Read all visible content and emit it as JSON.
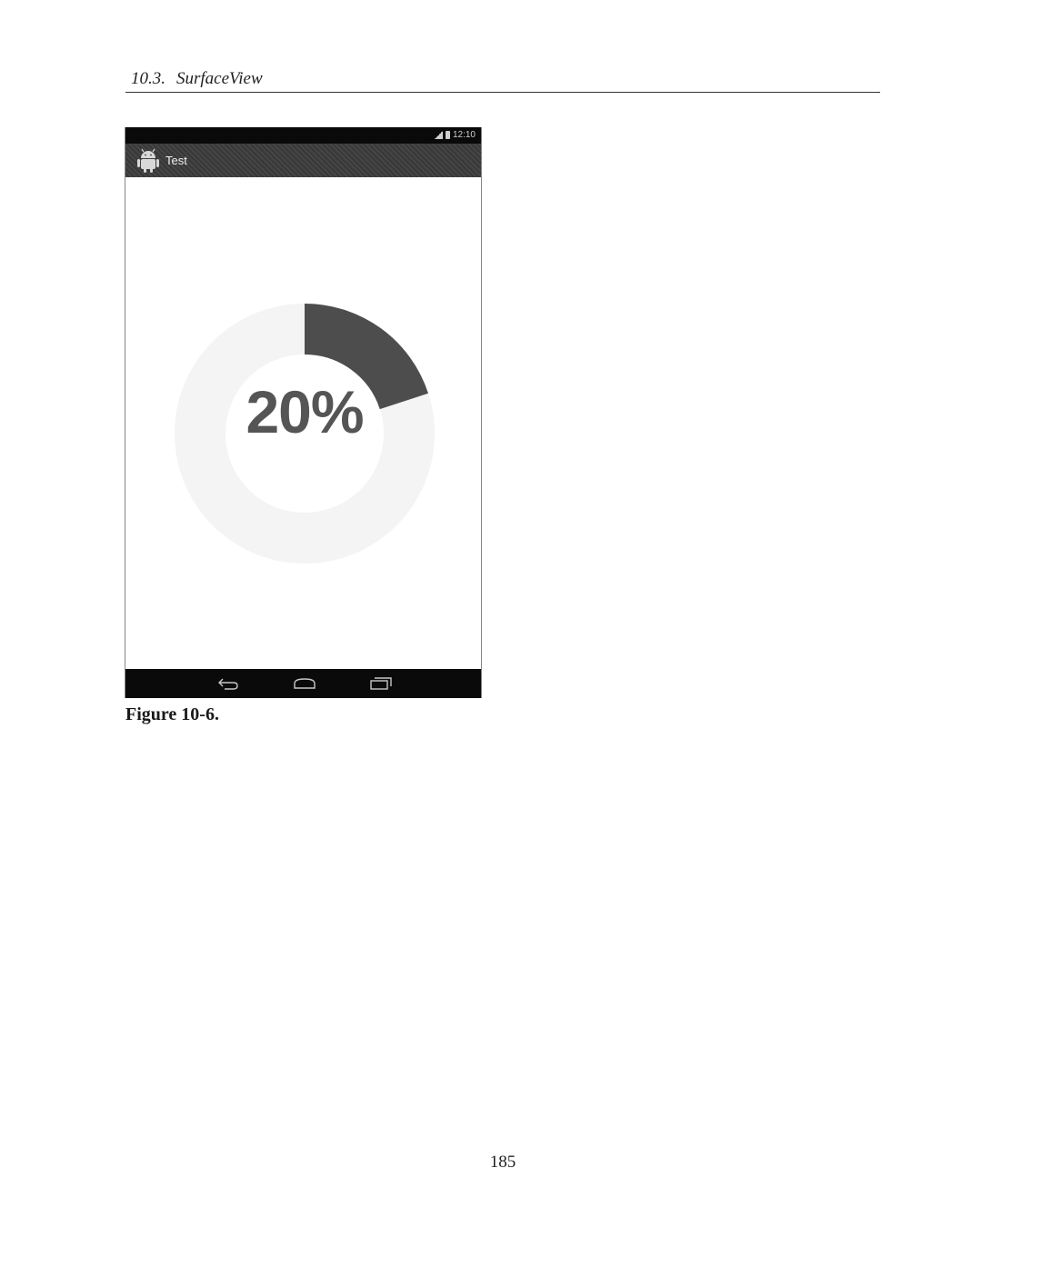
{
  "running_head": {
    "section_number": "10.3.",
    "section_title": "SurfaceView"
  },
  "screenshot": {
    "status_bar": {
      "time": "12:10",
      "icons": [
        "signal-icon",
        "battery-icon"
      ]
    },
    "action_bar": {
      "app_icon": "android-robot-icon",
      "title": "Test"
    },
    "progress": {
      "label": "20%",
      "value": 0.2,
      "arc_color": "#4d4d4d",
      "track_color": "#f4f4f4"
    },
    "nav_bar": {
      "icons": [
        "back-icon",
        "home-icon",
        "recent-apps-icon"
      ]
    }
  },
  "caption": "Figure 10-6.",
  "page_number": "185"
}
